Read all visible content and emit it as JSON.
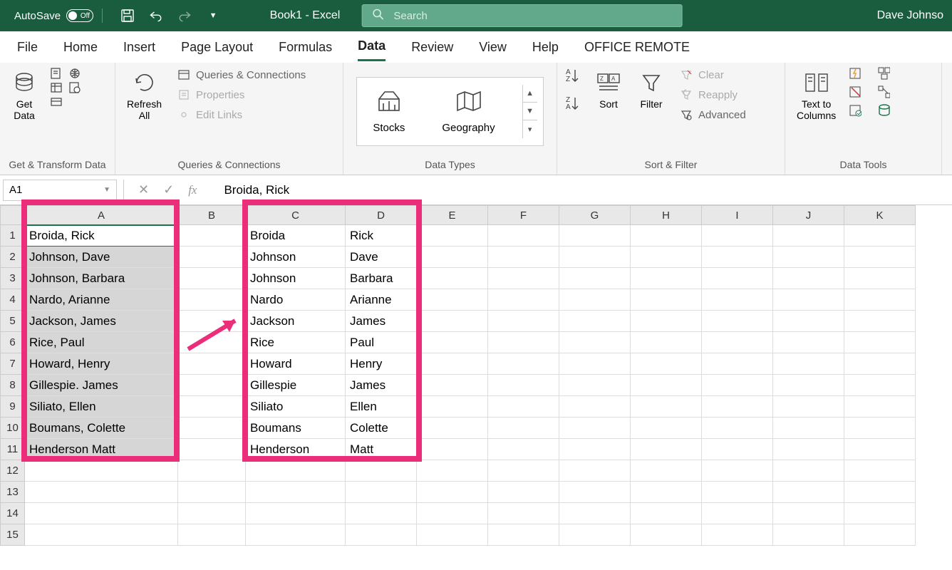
{
  "titlebar": {
    "autosave": "AutoSave",
    "autosave_state": "Off",
    "title": "Book1  -  Excel",
    "search_placeholder": "Search",
    "user": "Dave Johnso"
  },
  "tabs": [
    "File",
    "Home",
    "Insert",
    "Page Layout",
    "Formulas",
    "Data",
    "Review",
    "View",
    "Help",
    "OFFICE REMOTE"
  ],
  "active_tab": "Data",
  "ribbon": {
    "get_data": "Get\nData",
    "refresh_all": "Refresh\nAll",
    "queries_conn": "Queries & Connections",
    "properties": "Properties",
    "edit_links": "Edit Links",
    "stocks": "Stocks",
    "geography": "Geography",
    "sort": "Sort",
    "filter": "Filter",
    "clear": "Clear",
    "reapply": "Reapply",
    "advanced": "Advanced",
    "text_to_columns": "Text to\nColumns",
    "group_labels": {
      "g1": "Get & Transform Data",
      "g2": "Queries & Connections",
      "g3": "Data Types",
      "g4": "Sort & Filter",
      "g5": "Data Tools"
    }
  },
  "name_box": "A1",
  "formula": "Broida, Rick",
  "columns": [
    "A",
    "B",
    "C",
    "D",
    "E",
    "F",
    "G",
    "H",
    "I",
    "J",
    "K"
  ],
  "rows": [
    {
      "n": 1,
      "a": "Broida, Rick",
      "c": "Broida",
      "d": "Rick"
    },
    {
      "n": 2,
      "a": "Johnson, Dave",
      "c": "Johnson",
      "d": "Dave"
    },
    {
      "n": 3,
      "a": "Johnson, Barbara",
      "c": "Johnson",
      "d": "Barbara"
    },
    {
      "n": 4,
      "a": "Nardo, Arianne",
      "c": "Nardo",
      "d": "Arianne"
    },
    {
      "n": 5,
      "a": "Jackson, James",
      "c": "Jackson",
      "d": "James"
    },
    {
      "n": 6,
      "a": "Rice, Paul",
      "c": "Rice",
      "d": "Paul"
    },
    {
      "n": 7,
      "a": "Howard, Henry",
      "c": "Howard",
      "d": "Henry"
    },
    {
      "n": 8,
      "a": "Gillespie. James",
      "c": "Gillespie",
      "d": "James"
    },
    {
      "n": 9,
      "a": "Siliato, Ellen",
      "c": "Siliato",
      "d": "Ellen"
    },
    {
      "n": 10,
      "a": "Boumans, Colette",
      "c": "Boumans",
      "d": "Colette"
    },
    {
      "n": 11,
      "a": "Henderson Matt",
      "c": "Henderson",
      "d": "Matt"
    },
    {
      "n": 12,
      "a": "",
      "c": "",
      "d": ""
    },
    {
      "n": 13,
      "a": "",
      "c": "",
      "d": ""
    },
    {
      "n": 14,
      "a": "",
      "c": "",
      "d": ""
    },
    {
      "n": 15,
      "a": "",
      "c": "",
      "d": ""
    }
  ]
}
